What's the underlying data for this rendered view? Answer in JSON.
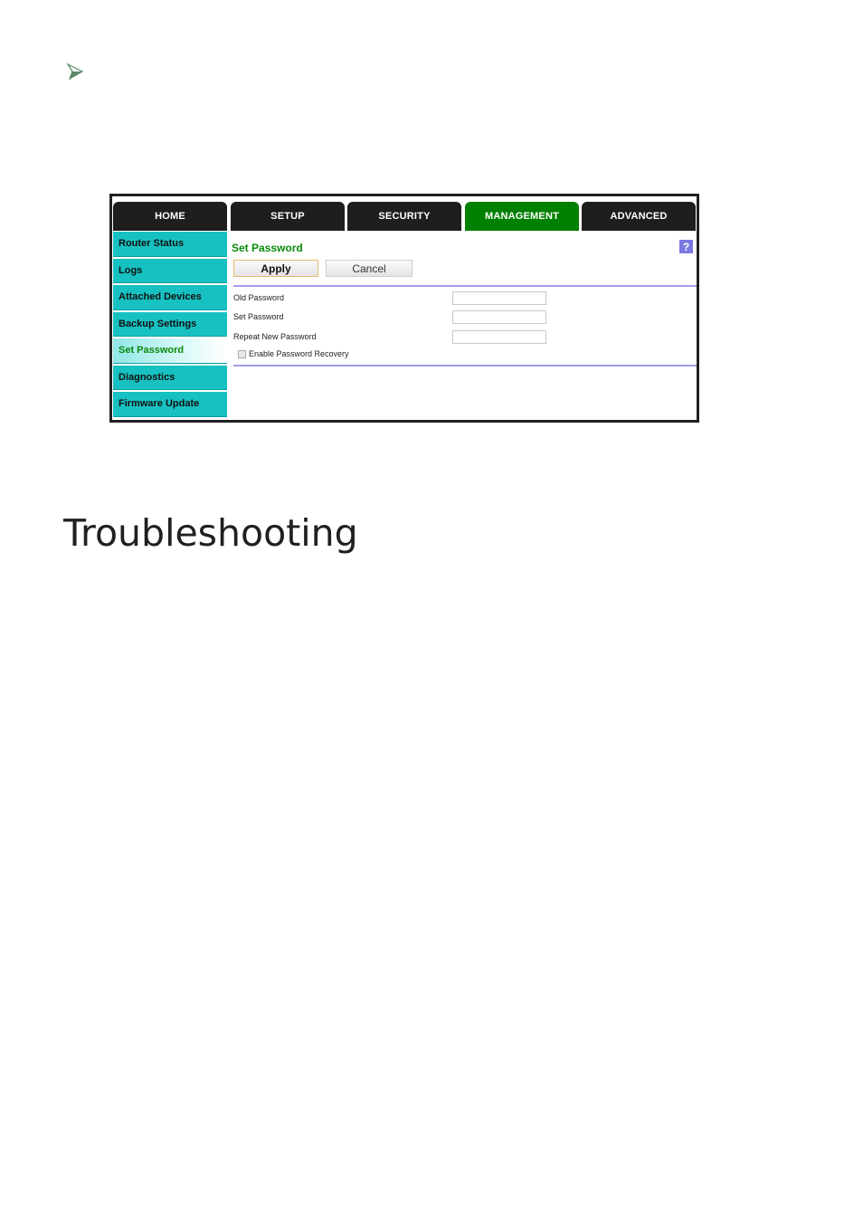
{
  "bullet": {
    "icon": "arrow-bullet-icon",
    "color": "#5a8a6a"
  },
  "router_ui": {
    "tabs": [
      {
        "label": "HOME",
        "active": false
      },
      {
        "label": "SETUP",
        "active": false
      },
      {
        "label": "SECURITY",
        "active": false
      },
      {
        "label": "MANAGEMENT",
        "active": true
      },
      {
        "label": "ADVANCED",
        "active": false
      }
    ],
    "sidebar": [
      {
        "label": "Router Status",
        "active": false
      },
      {
        "label": "Logs",
        "active": false
      },
      {
        "label": "Attached Devices",
        "active": false
      },
      {
        "label": "Backup Settings",
        "active": false
      },
      {
        "label": "Set Password",
        "active": true
      },
      {
        "label": "Diagnostics",
        "active": false
      },
      {
        "label": "Firmware Update",
        "active": false
      }
    ],
    "page_title": "Set Password",
    "help_icon": "?",
    "buttons": {
      "apply": "Apply",
      "cancel": "Cancel"
    },
    "fields": [
      {
        "label": "Old Password",
        "value": ""
      },
      {
        "label": "Set Password",
        "value": ""
      },
      {
        "label": "Repeat New Password",
        "value": ""
      }
    ],
    "checkbox": {
      "label": "Enable Password Recovery",
      "checked": false
    },
    "colors": {
      "active_tab": "#008000",
      "tab": "#1e1e1e",
      "sidebar": "#17c1c1",
      "accent_text": "#0a8a0a",
      "rule": "#a09ee8"
    }
  },
  "section_heading": "Troubleshooting"
}
